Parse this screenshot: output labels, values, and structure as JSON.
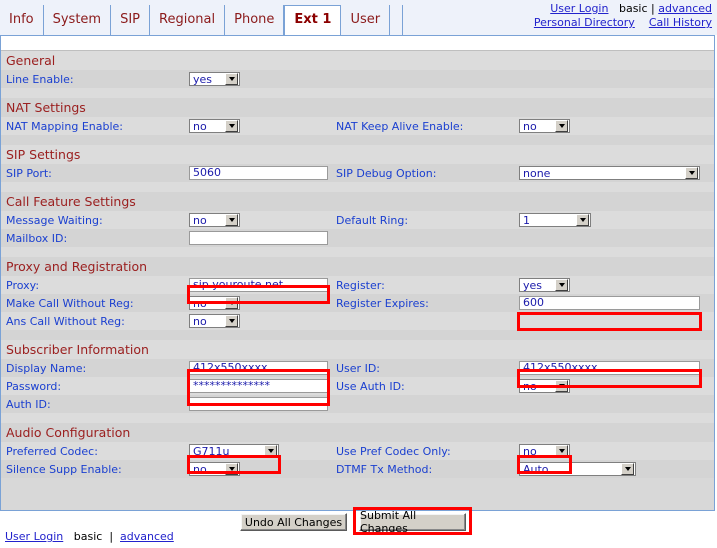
{
  "header": {
    "tabs": [
      {
        "label": "Info",
        "active": false
      },
      {
        "label": "System",
        "active": false
      },
      {
        "label": "SIP",
        "active": false
      },
      {
        "label": "Regional",
        "active": false
      },
      {
        "label": "Phone",
        "active": false
      },
      {
        "label": "Ext 1",
        "active": true
      },
      {
        "label": "User",
        "active": false
      }
    ],
    "links": {
      "user_login": "User Login",
      "basic": "basic",
      "separator": "|",
      "advanced": "advanced",
      "personal_directory": "Personal Directory",
      "call_history": "Call History"
    }
  },
  "sections": {
    "general": "General",
    "nat_settings": "NAT Settings",
    "sip_settings": "SIP Settings",
    "call_feature_settings": "Call Feature Settings",
    "proxy_and_registration": "Proxy and Registration",
    "subscriber_information": "Subscriber Information",
    "audio_configuration": "Audio Configuration"
  },
  "fields": {
    "line_enable": {
      "label": "Line Enable:",
      "value": "yes"
    },
    "nat_mapping_enable": {
      "label": "NAT Mapping Enable:",
      "value": "no"
    },
    "nat_keep_alive_enable": {
      "label": "NAT Keep Alive Enable:",
      "value": "no"
    },
    "sip_port": {
      "label": "SIP Port:",
      "value": "5060"
    },
    "sip_debug_option": {
      "label": "SIP Debug Option:",
      "value": "none"
    },
    "message_waiting": {
      "label": "Message Waiting:",
      "value": "no"
    },
    "default_ring": {
      "label": "Default Ring:",
      "value": "1"
    },
    "mailbox_id": {
      "label": "Mailbox ID:",
      "value": ""
    },
    "proxy": {
      "label": "Proxy:",
      "value": "sip.youroute.net"
    },
    "register": {
      "label": "Register:",
      "value": "yes"
    },
    "make_call_without_reg": {
      "label": "Make Call Without Reg:",
      "value": "no"
    },
    "register_expires": {
      "label": "Register Expires:",
      "value": "600"
    },
    "ans_call_without_reg": {
      "label": "Ans Call Without Reg:",
      "value": "no"
    },
    "display_name": {
      "label": "Display Name:",
      "value": "412x550xxxx"
    },
    "user_id": {
      "label": "User ID:",
      "value": "412x550xxxx"
    },
    "password": {
      "label": "Password:",
      "value": "**************"
    },
    "use_auth_id": {
      "label": "Use Auth ID:",
      "value": "no"
    },
    "auth_id": {
      "label": "Auth ID:",
      "value": ""
    },
    "preferred_codec": {
      "label": "Preferred Codec:",
      "value": "G711u"
    },
    "use_pref_codec_only": {
      "label": "Use Pref Codec Only:",
      "value": "no"
    },
    "silence_supp_enable": {
      "label": "Silence Supp Enable:",
      "value": "no"
    },
    "dtmf_tx_method": {
      "label": "DTMF Tx Method:",
      "value": "Auto"
    }
  },
  "buttons": {
    "undo": "Undo All Changes",
    "submit": "Submit All Changes"
  },
  "footer": {
    "user_login": "User Login",
    "basic": "basic",
    "separator": "|",
    "advanced": "advanced"
  },
  "colors": {
    "highlight": "#ff0000",
    "label": "#1a3fd0",
    "section": "#9b2020",
    "tab_active_text": "#8b0000"
  }
}
